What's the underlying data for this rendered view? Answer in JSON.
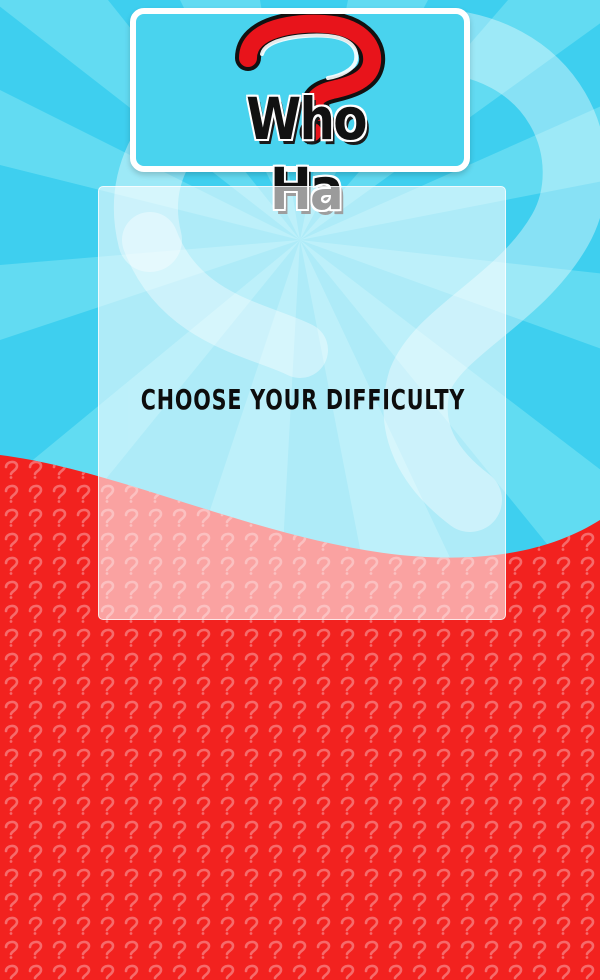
{
  "logo": {
    "text": "Who Ha",
    "icon": "question-mark-icon",
    "icon_color": "#e8141b"
  },
  "panel": {
    "heading": "CHOOSE YOUR DIFFICULTY"
  },
  "colors": {
    "sky_blue": "#3ecfef",
    "ray_blue": "#6fe0f2",
    "ground_red": "#f2221f",
    "pattern_red": "#f65a5a"
  }
}
